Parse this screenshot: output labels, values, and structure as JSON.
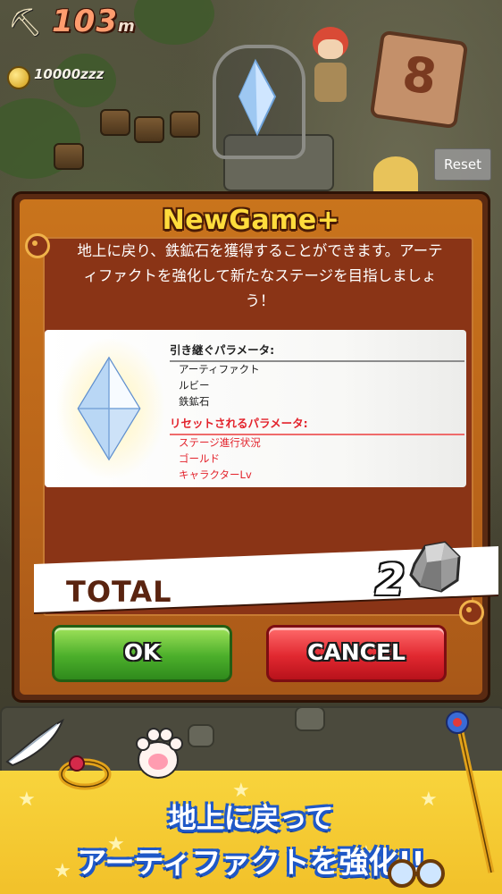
{
  "hud": {
    "depth_value": "103",
    "depth_unit": "m",
    "currency": "10000zzz",
    "icons": {
      "pickaxe": "pickaxe-icon",
      "coin": "coin-icon"
    }
  },
  "scene": {
    "reset_label": "Reset",
    "rune_symbol": "8"
  },
  "dialog": {
    "title": "NewGame+",
    "description": "地上に戻り、鉄鉱石を獲得することができます。アーティファクトを強化して新たなステージを目指しましょう！",
    "inherited": {
      "heading": "引き継ぐパラメータ:",
      "items": [
        "アーティファクト",
        "ルビー",
        "鉄鉱石"
      ]
    },
    "reset": {
      "heading": "リセットされるパラメータ:",
      "items": [
        "ステージ進行状況",
        "ゴールド",
        "キャラクターLv"
      ]
    },
    "total_label": "TOTAL",
    "total_value": "2",
    "ok_label": "OK",
    "cancel_label": "CANCEL"
  },
  "banner": {
    "line1": "地上に戻って",
    "line2": "アーティファクトを強化!!"
  },
  "colors": {
    "dialog_bg": "#b9641a",
    "dialog_plate": "#8a3416",
    "title": "#ffdc3c",
    "reset_red": "#e3232c",
    "ok_green": "#4caf2b",
    "cancel_red": "#e12830",
    "banner_yellow": "#f2c12a",
    "banner_blue": "#1f58c7"
  }
}
